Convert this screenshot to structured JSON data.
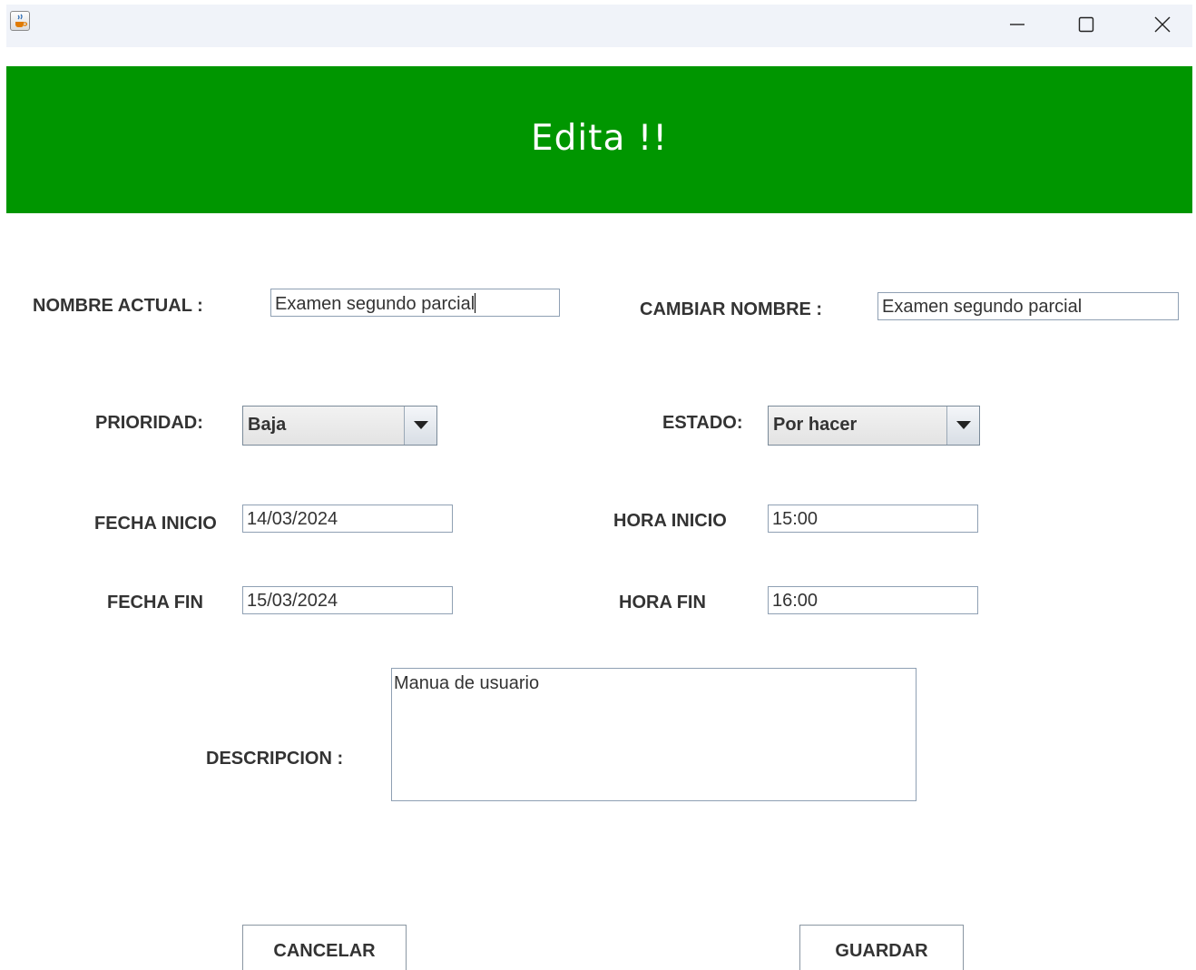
{
  "window": {
    "app_icon": "java-coffee-cup-icon",
    "controls": [
      "minimize-icon",
      "maximize-icon",
      "close-icon"
    ]
  },
  "banner": {
    "title": "Edita !!",
    "background_color": "#009600"
  },
  "form": {
    "nombre_actual_label": "NOMBRE ACTUAL :",
    "nombre_actual_value": "Examen segundo parcial",
    "cambiar_nombre_label": "CAMBIAR NOMBRE :",
    "cambiar_nombre_value": "Examen segundo parcial",
    "prioridad_label": "PRIORIDAD:",
    "prioridad_selected": "Baja",
    "estado_label": "ESTADO:",
    "estado_selected": "Por hacer",
    "fecha_inicio_label": "FECHA INICIO",
    "fecha_inicio_value": "14/03/2024",
    "hora_inicio_label": "HORA INICIO",
    "hora_inicio_value": "15:00",
    "fecha_fin_label": "FECHA FIN",
    "fecha_fin_value": "15/03/2024",
    "hora_fin_label": "HORA FIN",
    "hora_fin_value": "16:00",
    "descripcion_label": "DESCRIPCION :",
    "descripcion_value": "Manua de usuario"
  },
  "actions": {
    "cancel_label": "CANCELAR",
    "save_label": "GUARDAR"
  }
}
